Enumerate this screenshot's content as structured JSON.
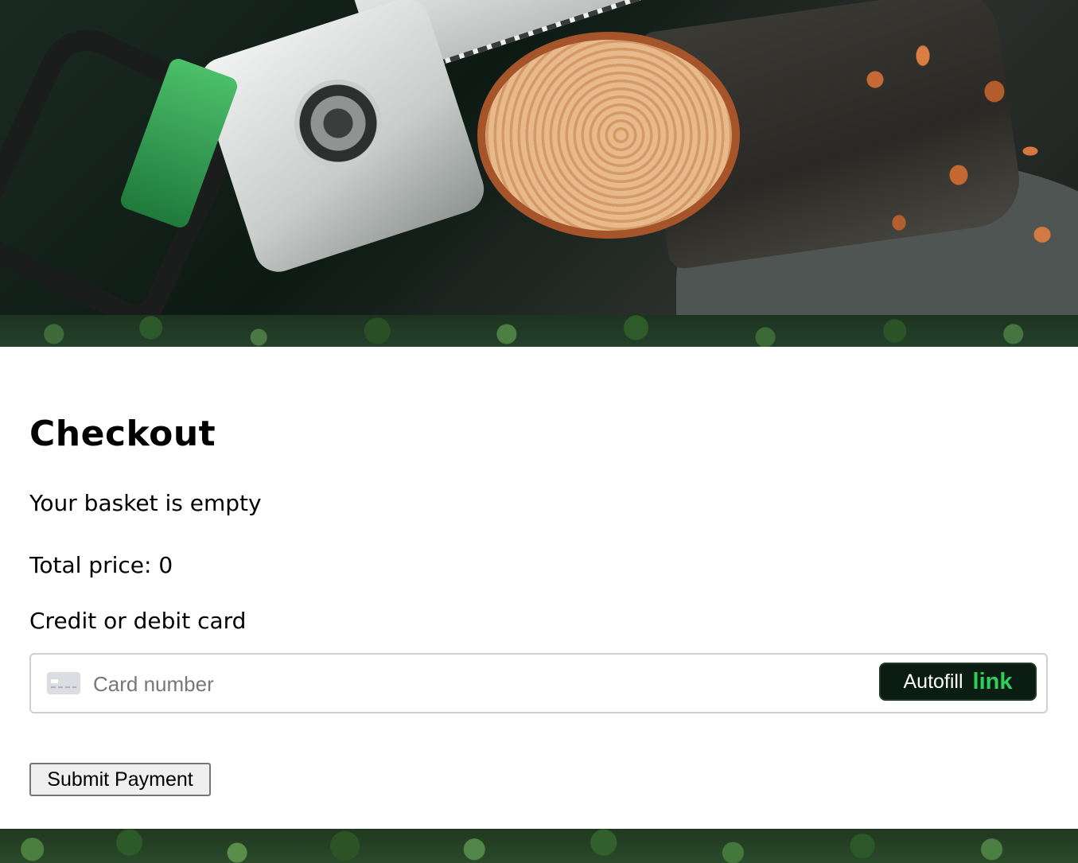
{
  "hero": {
    "image_description_icon": "chainsaw-cutting-log-banner"
  },
  "checkout": {
    "title": "Checkout",
    "basket_status": "Your basket is empty",
    "total_price": "Total price: 0",
    "card_label": "Credit or debit card",
    "card_input": {
      "placeholder": "Card number",
      "value": "",
      "icon": "credit-card-icon"
    },
    "autofill": {
      "label": "Autofill",
      "brand": "link"
    },
    "submit_label": "Submit Payment"
  },
  "colors": {
    "autofill_bg": "#0b1d12",
    "autofill_link": "#2ed05b",
    "forest_green": "#2d5a2a"
  }
}
